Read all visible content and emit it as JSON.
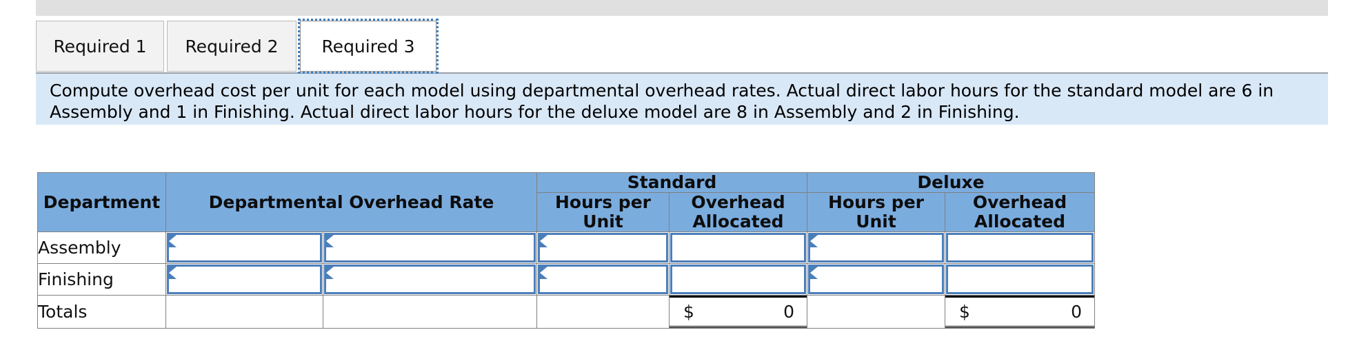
{
  "tabs": [
    {
      "label": "Required 1",
      "active": false
    },
    {
      "label": "Required 2",
      "active": false
    },
    {
      "label": "Required 3",
      "active": true
    }
  ],
  "prompt": {
    "text": "Compute overhead cost per unit for each model using departmental overhead rates. Actual direct labor hours for the standard model are 6 in Assembly and 1 in Finishing. Actual direct labor hours for the deluxe model are 8 in Assembly and 2 in Finishing."
  },
  "table": {
    "group_headers": {
      "department": "Department",
      "rate": "Departmental Overhead Rate",
      "standard": "Standard",
      "deluxe": "Deluxe"
    },
    "sub_headers": {
      "standard_hours": "Hours per Unit",
      "standard_overhead_line1": "Overhead",
      "standard_overhead_line2": "Allocated",
      "deluxe_hours": "Hours per Unit",
      "deluxe_overhead_line1": "Overhead",
      "deluxe_overhead_line2": "Allocated"
    },
    "rows": [
      {
        "department": "Assembly",
        "rate_a": "",
        "rate_b": "",
        "standard_hours": "",
        "standard_overhead": "",
        "deluxe_hours": "",
        "deluxe_overhead": ""
      },
      {
        "department": "Finishing",
        "rate_a": "",
        "rate_b": "",
        "standard_hours": "",
        "standard_overhead": "",
        "deluxe_hours": "",
        "deluxe_overhead": ""
      }
    ],
    "totals": {
      "department": "Totals",
      "standard_currency": "$",
      "standard_value": "0",
      "deluxe_currency": "$",
      "deluxe_value": "0"
    }
  },
  "colors": {
    "header_blue": "#7bacde",
    "prompt_blue": "#d9e8f7",
    "entry_border": "#4a7ebb",
    "focus_outline": "#3f7fbf",
    "strip_gray": "#e0e0e0"
  }
}
